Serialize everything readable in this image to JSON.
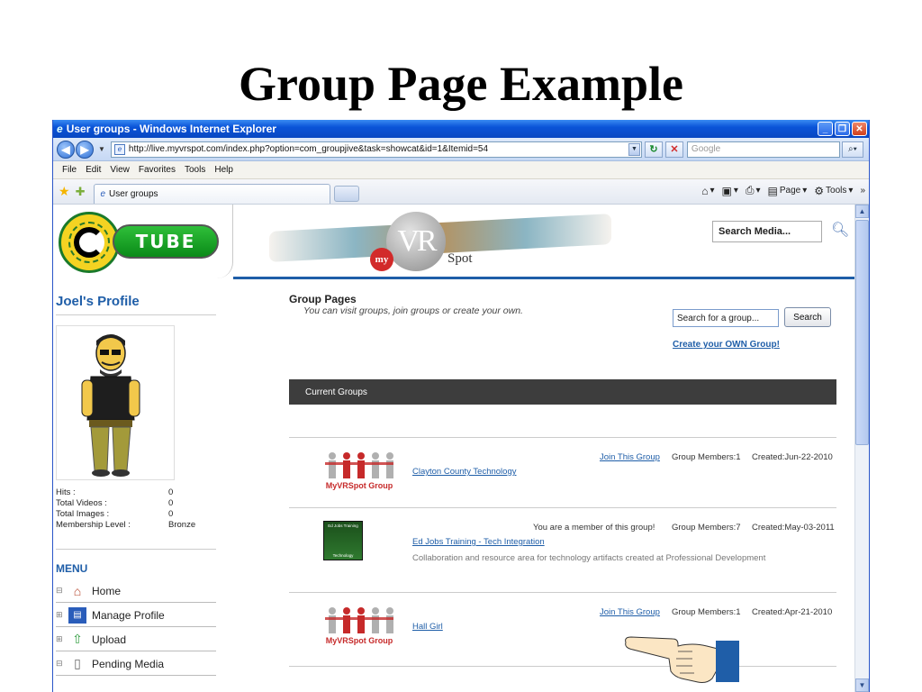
{
  "slide": {
    "title": "Group Page Example"
  },
  "window": {
    "title": "User groups - Windows Internet Explorer",
    "controls": [
      "_",
      "❐",
      "✕"
    ]
  },
  "addressbar": {
    "url": "http://live.myvrspot.com/index.php?option=com_groupjive&task=showcat&id=1&Itemid=54",
    "search_placeholder": "Google"
  },
  "menubar": {
    "items": [
      "File",
      "Edit",
      "View",
      "Favorites",
      "Tools",
      "Help"
    ]
  },
  "tabbar": {
    "active_tab": "User groups",
    "commands": [
      "Page",
      "Tools"
    ]
  },
  "site": {
    "tube_logo": "TUBE",
    "vr_logo": "VR",
    "my_badge": "my",
    "spot_label": "Spot",
    "search_media_placeholder": "Search Media..."
  },
  "profile": {
    "title": "Joel's Profile",
    "stats": [
      {
        "label": "Hits :",
        "value": "0"
      },
      {
        "label": "Total Videos :",
        "value": "0"
      },
      {
        "label": "Total Images :",
        "value": "0"
      },
      {
        "label": "Membership Level :",
        "value": "Bronze"
      }
    ]
  },
  "menu": {
    "title": "MENU",
    "items": [
      {
        "label": "Home",
        "icon": "home-icon"
      },
      {
        "label": "Manage Profile",
        "icon": "profile-icon"
      },
      {
        "label": "Upload",
        "icon": "upload-icon"
      },
      {
        "label": "Pending Media",
        "icon": "clipboard-icon"
      }
    ]
  },
  "groups_page": {
    "heading": "Group Pages",
    "subheading": "You can visit groups, join groups or create your own.",
    "search_placeholder": "Search for a group...",
    "search_button": "Search",
    "create_link": "Create your OWN Group!",
    "current_groups_label": "Current Groups",
    "groups": [
      {
        "name": "Clayton County Technology",
        "status": "Join This Group",
        "status_is_link": true,
        "members": "Group Members:1",
        "created": "Created:Jun-22-2010",
        "thumb": "MyVRSpot Group",
        "description": ""
      },
      {
        "name": "Ed Jobs Training - Tech Integration",
        "status": "You are a member of this group!",
        "status_is_link": false,
        "members": "Group Members:7",
        "created": "Created:May-03-2011",
        "thumb": "Ed Jobs Training",
        "thumb_footer": "Technology",
        "description": "Collaboration and resource area for technology artifacts created at Professional Development"
      },
      {
        "name": "Hall Girl",
        "status": "Join This Group",
        "status_is_link": true,
        "members": "Group Members:1",
        "created": "Created:Apr-21-2010",
        "thumb": "MyVRSpot Group",
        "description": ""
      }
    ]
  },
  "colors": {
    "brand_blue": "#1f5ea8",
    "dark_bar": "#3d3d3d",
    "ie_titlebar": "#0a54d8",
    "tube_green": "#1a9a2a"
  }
}
